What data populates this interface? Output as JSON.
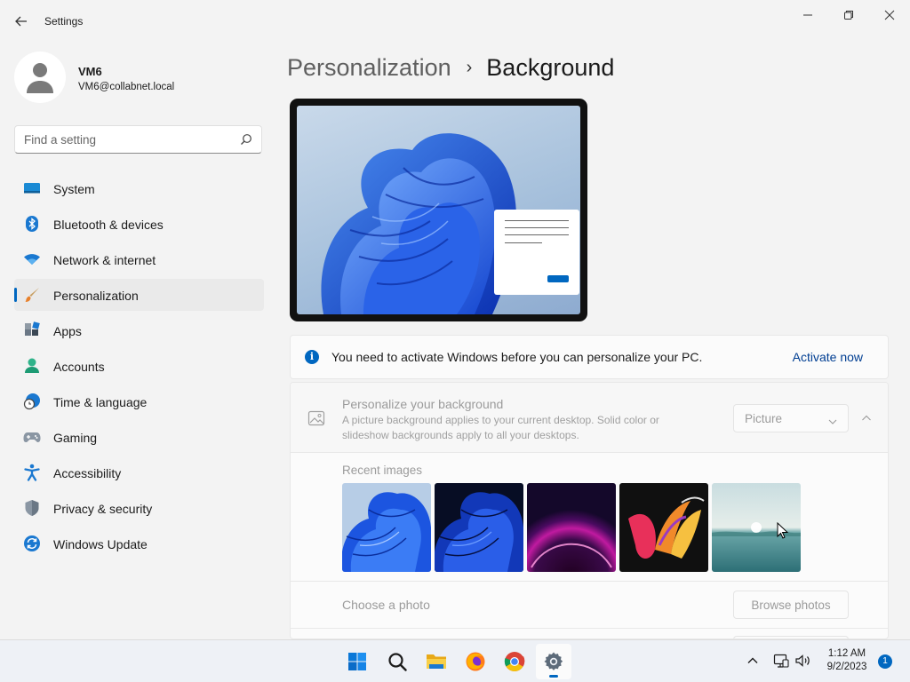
{
  "window": {
    "title": "Settings",
    "back_icon": "back-arrow-icon",
    "controls": [
      "minimize-icon",
      "restore-icon",
      "close-icon"
    ]
  },
  "profile": {
    "name": "VM6",
    "email": "VM6@collabnet.local"
  },
  "search": {
    "placeholder": "Find a setting",
    "value": ""
  },
  "sidebar": {
    "active": "Personalization",
    "items": [
      {
        "label": "System",
        "icon": "system-icon"
      },
      {
        "label": "Bluetooth & devices",
        "icon": "bluetooth-icon"
      },
      {
        "label": "Network & internet",
        "icon": "wifi-icon"
      },
      {
        "label": "Personalization",
        "icon": "brush-icon"
      },
      {
        "label": "Apps",
        "icon": "apps-icon"
      },
      {
        "label": "Accounts",
        "icon": "account-icon"
      },
      {
        "label": "Time & language",
        "icon": "clock-globe-icon"
      },
      {
        "label": "Gaming",
        "icon": "controller-icon"
      },
      {
        "label": "Accessibility",
        "icon": "accessibility-icon"
      },
      {
        "label": "Privacy & security",
        "icon": "shield-icon"
      },
      {
        "label": "Windows Update",
        "icon": "update-icon"
      }
    ]
  },
  "breadcrumb": {
    "parent": "Personalization",
    "separator": "›",
    "current": "Background"
  },
  "activation_banner": {
    "text": "You need to activate Windows before you can personalize your PC.",
    "link": "Activate now"
  },
  "background_card": {
    "title": "Personalize your background",
    "description": "A picture background applies to your current desktop. Solid color or slideshow backgrounds apply to all your desktops.",
    "dropdown_value": "Picture",
    "recent_label": "Recent images",
    "recent_images": [
      "bloom-blue-light",
      "bloom-blue-dark",
      "purple-glow",
      "colorful-ribbon",
      "lake-sunrise"
    ],
    "choose_label": "Choose a photo",
    "browse_label": "Browse photos"
  },
  "taskbar": {
    "apps": [
      "windows-start-icon",
      "search-icon",
      "file-explorer-icon",
      "firefox-icon",
      "chrome-icon",
      "settings-icon"
    ],
    "active_app": "settings-icon",
    "time": "1:12 AM",
    "date": "9/2/2023",
    "notification_count": "1"
  },
  "colors": {
    "accent": "#0067c0",
    "link": "#003e92",
    "sidebar_bg": "#f3f3f3",
    "card_bg": "#fbfbfb"
  }
}
